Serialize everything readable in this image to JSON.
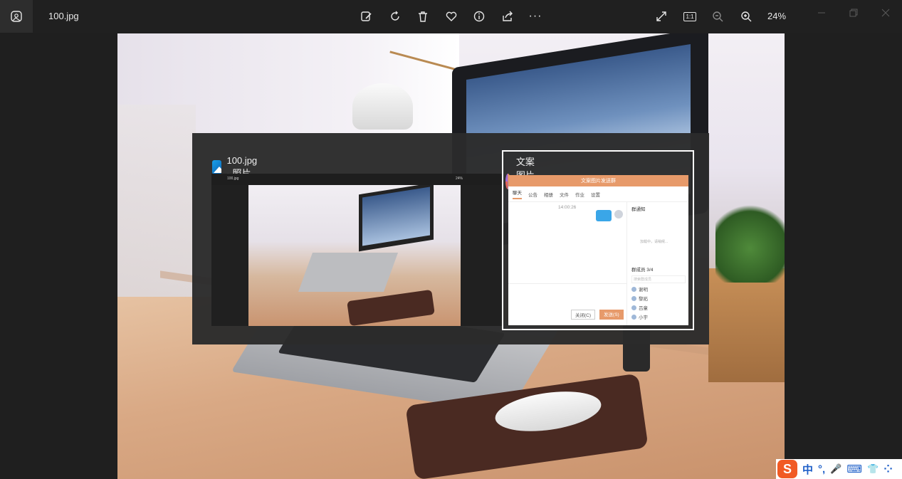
{
  "app": {
    "filename": "100.jpg",
    "zoom": "24%",
    "toolbar_icons": [
      "edit-image-icon",
      "rotate-icon",
      "delete-icon",
      "favorite-icon",
      "info-icon",
      "share-icon",
      "more-icon",
      "fullscreen-icon",
      "actual-size-icon",
      "zoom-out-icon",
      "zoom-in-icon"
    ],
    "more_label": "···",
    "actual_size_label": "1:1"
  },
  "switcher": {
    "windows": [
      {
        "title": "100.jpg - 照片",
        "icon": "photos-app-icon",
        "selected": false,
        "thumb": {
          "filename": "100.jpg",
          "zoom": "24%"
        }
      },
      {
        "title": "文案图片发送群",
        "icon": "chat-app-icon",
        "selected": true,
        "thumb": {
          "header": "文案图片发送群",
          "tabs": [
            "聊天",
            "公告",
            "相册",
            "文件",
            "作业",
            "设置"
          ],
          "time": "14:00:26",
          "side_title": "群通知",
          "side_placeholder": "加载中，请稍候...",
          "members_label": "群成员 3/4",
          "search_placeholder": "搜索群成员",
          "members": [
            "谢明",
            "黎拓",
            "吕童",
            "小宇"
          ],
          "close_label": "关闭(C)",
          "send_label": "发送(S)"
        }
      }
    ]
  },
  "ime": {
    "logo": "S",
    "items": [
      "中",
      "°,",
      "🎤",
      "⌨",
      "👕",
      "⁘"
    ]
  },
  "colors": {
    "titlebar": "#202020",
    "switcher_bg": "#2b2b2b",
    "chat_accent": "#e79a6a",
    "ime_blue": "#1e5fc8"
  }
}
